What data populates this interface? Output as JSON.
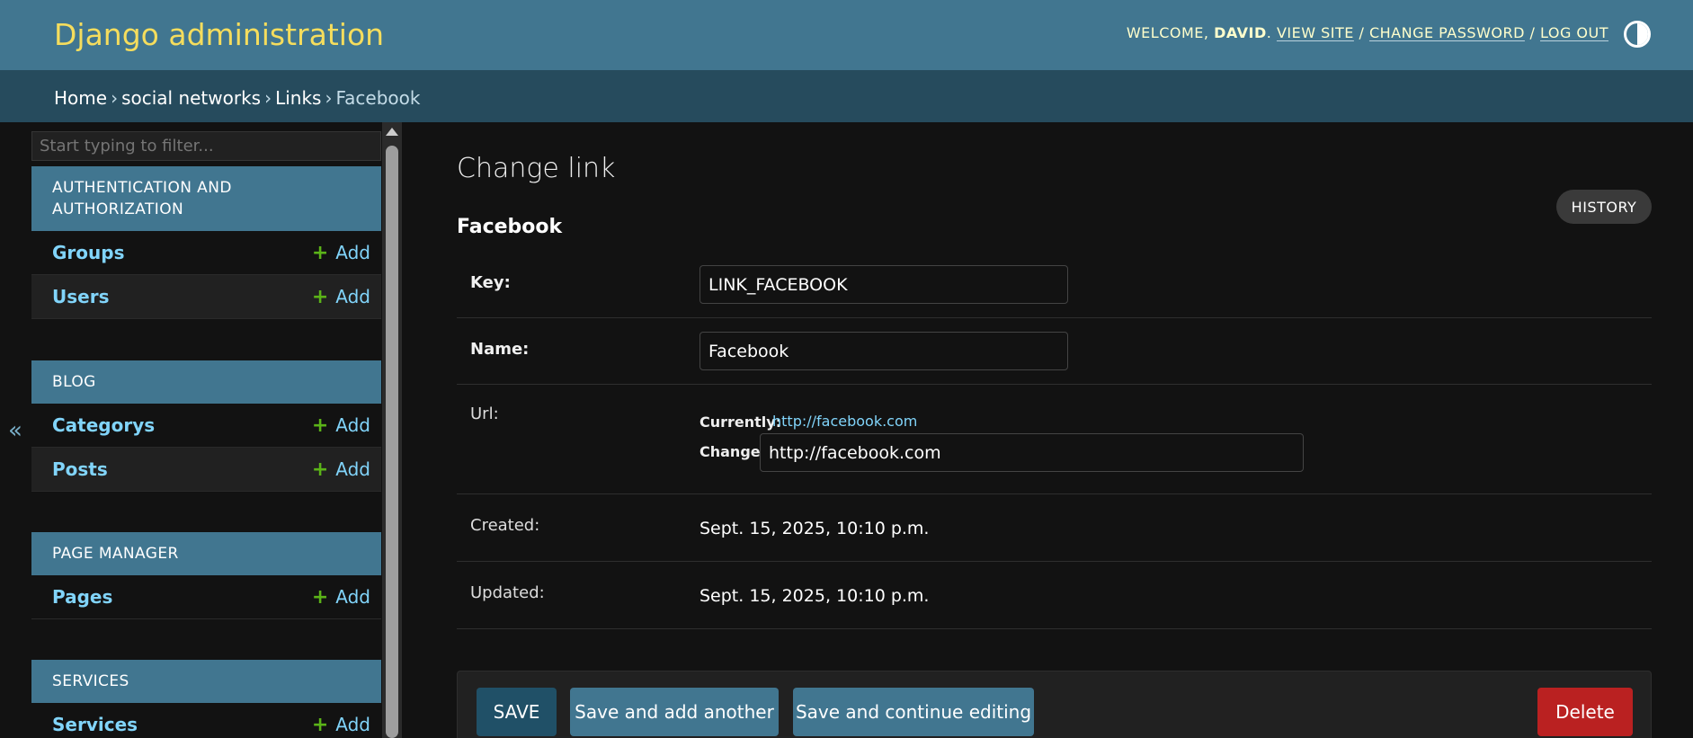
{
  "header": {
    "site_name": "Django administration",
    "welcome_prefix": "WELCOME, ",
    "username": "DAVID",
    "welcome_suffix": ".",
    "view_site": "VIEW SITE",
    "separator": "/",
    "change_password": "CHANGE PASSWORD",
    "log_out": "LOG OUT",
    "theme_icon": "contrast-icon"
  },
  "breadcrumbs": {
    "items": [
      "Home",
      "social networks",
      "Links"
    ],
    "current": "Facebook",
    "sep": "›"
  },
  "sidebar": {
    "collapse_glyph": "«",
    "filter_placeholder": "Start typing to filter...",
    "add_label": "Add",
    "modules": [
      {
        "caption": "AUTHENTICATION AND AUTHORIZATION",
        "models": [
          "Groups",
          "Users"
        ]
      },
      {
        "caption": "BLOG",
        "models": [
          "Categorys",
          "Posts"
        ]
      },
      {
        "caption": "PAGE MANAGER",
        "models": [
          "Pages"
        ]
      },
      {
        "caption": "SERVICES",
        "models": [
          "Services"
        ]
      }
    ]
  },
  "content": {
    "title": "Change link",
    "history": "HISTORY",
    "object_name": "Facebook",
    "fields": {
      "key": {
        "label": "Key:",
        "value": "LINK_FACEBOOK"
      },
      "name": {
        "label": "Name:",
        "value": "Facebook"
      },
      "url": {
        "label": "Url:",
        "currently_label": "Currently:",
        "currently_value": "http://facebook.com",
        "change_label": "Change:",
        "value": "http://facebook.com"
      },
      "created": {
        "label": "Created:",
        "value": "Sept. 15, 2025, 10:10 p.m."
      },
      "updated": {
        "label": "Updated:",
        "value": "Sept. 15, 2025, 10:10 p.m."
      }
    }
  },
  "submit": {
    "save": "SAVE",
    "save_add_another": "Save and add another",
    "save_continue": "Save and continue editing",
    "delete": "Delete"
  },
  "colors": {
    "header_bg": "#417690",
    "breadcrumbs_bg": "#264b5d",
    "brand_text": "#f5dd5d",
    "link": "#81d4fa",
    "add_plus": "#5bb318",
    "delete_bg": "#ba2121",
    "page_bg": "#121212"
  }
}
